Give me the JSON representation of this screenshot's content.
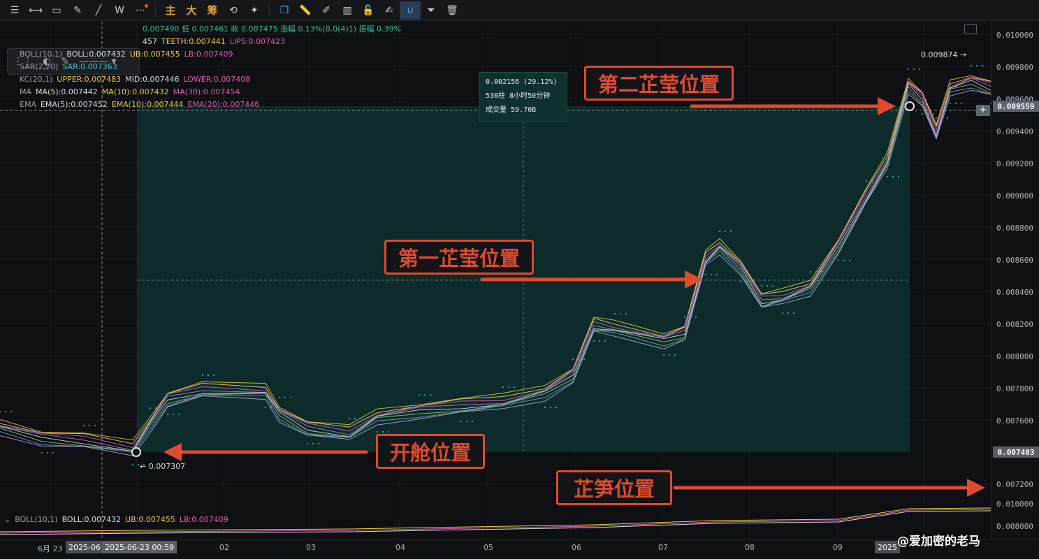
{
  "toolbar": {
    "text_buttons": [
      "主",
      "大",
      "筹"
    ]
  },
  "legend": {
    "ohlc": "0.007490 低 0.007461 收 0.007475 涨幅 0.13%(0.0(4)1) 振幅 0.39%",
    "alligator_jaw": "457",
    "alligator_teeth": "TEETH:0.007441",
    "alligator_lips": "LIPS:0.007423",
    "boll_name": "BOLL(10,1)",
    "boll_mid": "BOLL:0.007432",
    "boll_ub": "UB:0.007455",
    "boll_lb": "LB:0.007409",
    "sar_name": "SAR(2,20)",
    "sar_value": "SAR:0.007363",
    "kc_name": "KC(20,1)",
    "kc_upper": "UPPER:0.007483",
    "kc_mid": "MID:0.007446",
    "kc_lower": "LOWER:0.007408",
    "ma_name": "MA",
    "ma5": "MA(5):0.007442",
    "ma10": "MA(10):0.007432",
    "ma30": "MA(30):0.007454",
    "ema_name": "EMA",
    "ema5": "EMA(5):0.007452",
    "ema10": "EMA(10):0.007444",
    "ema20": "EMA(20):0.007446"
  },
  "measure": {
    "change": "0.002156 (29.12%)",
    "bars": "530柱 8小时50分钟",
    "volume": "成交量 59.70B"
  },
  "annotations": {
    "second_peak": "第二芷莹位置",
    "first_peak": "第一芷莹位置",
    "open": "开舱位置",
    "bottom": "芷笋位置"
  },
  "markers": {
    "low_price": "0.007307",
    "high_price": "0.009874"
  },
  "price_axis": {
    "labels": [
      "0.010000",
      "0.009800",
      "0.009600",
      "0.009400",
      "0.009200",
      "0.009000",
      "0.008800",
      "0.008600",
      "0.008400",
      "0.008200",
      "0.008000",
      "0.007800",
      "0.007600",
      "0.007200",
      "0.010000",
      "0.008000"
    ],
    "tag_high": "0.009559",
    "tag_low": "0.007403"
  },
  "sub_legend": {
    "name": "BOLL(10,1)",
    "mid": "BOLL:0.007432",
    "ub": "UB:0.007455",
    "lb": "LB:0.007409"
  },
  "time_axis": {
    "labels": [
      "6月 23",
      "02",
      "03",
      "04",
      "05",
      "06",
      "07",
      "08",
      "09"
    ],
    "tag_start_partial": "2025-06",
    "tag_cursor": "2025-06-23 00:59",
    "tag_end_partial": "2025"
  },
  "watermark": "@爱加密的老马",
  "colors": {
    "accent_blue": "#4aa3ff",
    "annotation_red": "#e04a2e",
    "measure_fill": "#0e3533"
  }
}
